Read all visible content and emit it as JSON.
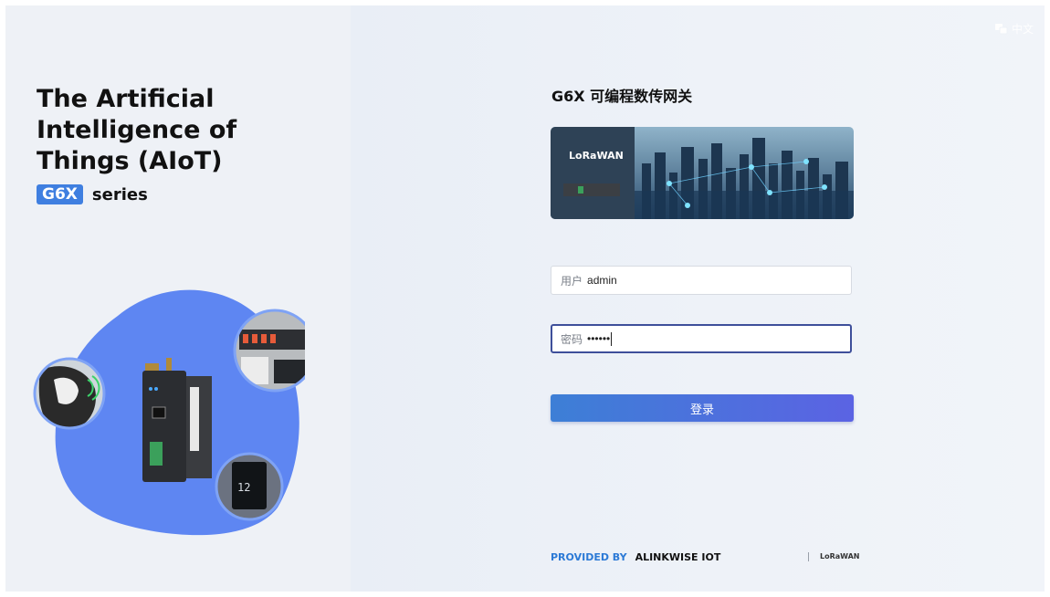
{
  "left_panel": {
    "headline_lines": [
      "The Artificial",
      "Intelligence of",
      "Things (AIoT)"
    ],
    "series_badge": "G6X",
    "series_text": "series"
  },
  "language": {
    "icon": "translate-icon",
    "label": "中文"
  },
  "login": {
    "title": "G6X 可编程数传网关",
    "banner_logo": "LoRaWAN",
    "username": {
      "label": "用户",
      "value": "admin"
    },
    "password": {
      "label": "密码",
      "value": "••••••"
    },
    "submit_label": "登录"
  },
  "footer": {
    "provided_by": "PROVIDED BY",
    "company": "ALINKWISE IOT",
    "logo_text": "LoRaWAN"
  },
  "colors": {
    "accent": "#3f7fe0",
    "button_start": "#3d7fd6",
    "button_end": "#5b63e3",
    "blob": "#5e86f2"
  }
}
